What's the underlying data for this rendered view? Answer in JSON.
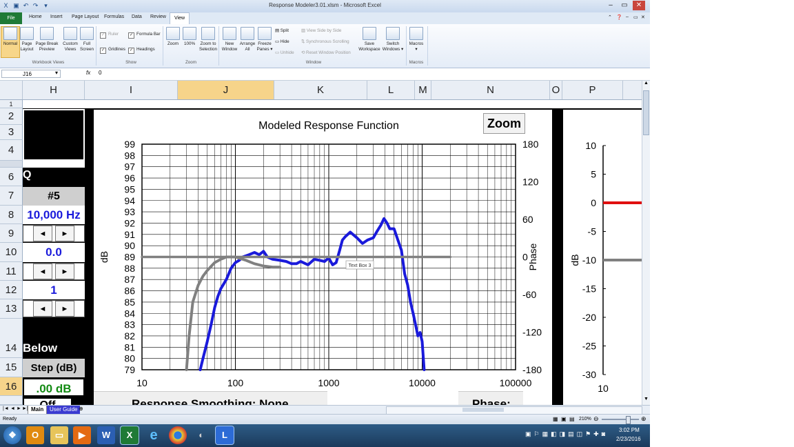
{
  "window": {
    "title": "Response Modeler3.01.xlsm - Microsoft Excel"
  },
  "ribbon": {
    "tabs": [
      "Home",
      "Insert",
      "Page Layout",
      "Formulas",
      "Data",
      "Review",
      "View"
    ],
    "file_tab": "File",
    "active_tab": "View",
    "groups": {
      "workbook_views": {
        "label": "Workbook Views",
        "normal": "Normal",
        "page_layout": [
          "Page",
          "Layout"
        ],
        "page_break": [
          "Page Break",
          "Preview"
        ],
        "custom_views": [
          "Custom",
          "Views"
        ],
        "full_screen": [
          "Full",
          "Screen"
        ]
      },
      "show": {
        "label": "Show",
        "ruler": "Ruler",
        "formula_bar": "Formula Bar",
        "gridlines": "Gridlines",
        "headings": "Headings"
      },
      "zoom": {
        "label": "Zoom",
        "zoom": "Zoom",
        "hundred": "100%",
        "zoom_to_selection": [
          "Zoom to",
          "Selection"
        ]
      },
      "window": {
        "label": "Window",
        "new_window": [
          "New",
          "Window"
        ],
        "arrange_all": [
          "Arrange",
          "All"
        ],
        "freeze_panes": [
          "Freeze",
          "Panes ▾"
        ],
        "split": "Split",
        "hide": "Hide",
        "unhide": "Unhide",
        "view_side": "View Side by Side",
        "sync_scroll": "Synchronous Scrolling",
        "reset_pos": "Reset Window Position",
        "save_workspace": [
          "Save",
          "Workspace"
        ],
        "switch_windows": [
          "Switch",
          "Windows ▾"
        ]
      },
      "macros": {
        "label": "Macros",
        "macros": "Macros"
      }
    }
  },
  "formula_bar": {
    "name_box": "J16",
    "fx": "fx",
    "value": "0"
  },
  "columns": [
    "H",
    "I",
    "J",
    "K",
    "L",
    "M",
    "N",
    "O",
    "P"
  ],
  "rows": [
    "1",
    "2",
    "3",
    "4",
    "6",
    "7",
    "8",
    "9",
    "10",
    "11",
    "12",
    "13",
    "14",
    "15",
    "16"
  ],
  "panel": {
    "q_label": "Q",
    "band": "#5",
    "freq": "10,000 Hz",
    "gain": "0.0",
    "q_value": "1",
    "below": "Below",
    "step_label": "Step (dB)",
    "step_value": ".00 dB",
    "off_label": "Off",
    "arrow_left": "◄",
    "arrow_right": "►"
  },
  "chart_main": {
    "title": "Modeled Response Function",
    "zoom_button": "Zoom",
    "y_left_label": "dB",
    "y_right_label": "Phase",
    "y_ticks": [
      "99",
      "98",
      "97",
      "96",
      "95",
      "94",
      "93",
      "92",
      "91",
      "90",
      "89",
      "88",
      "87",
      "86",
      "85",
      "84",
      "83",
      "82",
      "81",
      "80",
      "79"
    ],
    "phase_ticks": [
      "180",
      "120",
      "60",
      "0",
      "-60",
      "-120",
      "-180"
    ],
    "x_ticks": [
      "10",
      "100",
      "1000",
      "10000",
      "100000"
    ],
    "textbox_label": "Text Box 3",
    "smoothing_label": "Response  Smoothing:  None",
    "phase_label": "Phase:"
  },
  "chart_data": [
    {
      "type": "line",
      "title": "Modeled Response Function",
      "xlabel": "",
      "ylabel": "dB",
      "y2label": "Phase",
      "xscale": "log",
      "xlim": [
        10,
        100000
      ],
      "ylim": [
        79,
        99
      ],
      "y2lim": [
        -180,
        180
      ],
      "grid": true,
      "series": [
        {
          "color": "#1a1adb",
          "axis": "left",
          "x": [
            42,
            45,
            50,
            55,
            60,
            65,
            70,
            80,
            90,
            100,
            110,
            120,
            140,
            160,
            180,
            200,
            220,
            250,
            300,
            350,
            400,
            450,
            500,
            600,
            700,
            800,
            900,
            1000,
            1100,
            1200,
            1300,
            1400,
            1500,
            1700,
            2000,
            2300,
            2600,
            3000,
            3300,
            3600,
            3900,
            4200,
            4500,
            5000,
            5500,
            6000,
            6500,
            7000,
            7500,
            8000,
            8500,
            9000,
            9500,
            10000,
            10500
          ],
          "y": [
            79,
            80,
            81.5,
            83,
            84.5,
            85.5,
            86.2,
            87,
            88,
            88.5,
            88.7,
            89,
            89.2,
            89.4,
            89.2,
            89.5,
            89,
            88.8,
            88.7,
            88.6,
            88.4,
            88.4,
            88.6,
            88.3,
            88.8,
            88.7,
            88.6,
            88.9,
            88.3,
            88.5,
            89.5,
            90.5,
            90.8,
            91.2,
            90.7,
            90.2,
            90.5,
            90.7,
            91.3,
            91.8,
            92.4,
            92,
            91.5,
            91.5,
            90.5,
            89.6,
            87.5,
            86.5,
            85,
            84,
            83,
            82,
            82.3,
            81.5,
            79
          ]
        },
        {
          "color": "#808080",
          "axis": "left",
          "x": [
            30,
            32,
            35,
            40,
            45,
            50,
            60,
            70,
            80,
            90,
            100,
            130,
            160,
            200,
            250,
            300
          ],
          "y": [
            79,
            82,
            85,
            86.5,
            87.3,
            87.8,
            88.5,
            88.8,
            89,
            89,
            89,
            88.7,
            88.4,
            88.2,
            88.1,
            88.1
          ]
        },
        {
          "color": "#808080",
          "axis": "right",
          "x": [
            10,
            20000
          ],
          "y": [
            0,
            0
          ]
        }
      ]
    },
    {
      "type": "line",
      "xlabel": "",
      "ylabel": "dB",
      "ylim": [
        -30,
        10
      ],
      "y_ticks": [
        "10",
        "5",
        "0",
        "-5",
        "-10",
        "-15",
        "-20",
        "-25",
        "-30"
      ],
      "x_first_tick": "10",
      "series": [
        {
          "color": "#e01010",
          "x": [
            10,
            100000
          ],
          "y": [
            0,
            0
          ]
        },
        {
          "color": "#808080",
          "x": [
            10,
            100000
          ],
          "y": [
            -10,
            -10
          ]
        }
      ]
    }
  ],
  "sheet_tabs": [
    "Main",
    "User Guide"
  ],
  "status": {
    "ready": "Ready",
    "zoom": "210%"
  },
  "clock": {
    "time": "3:02 PM",
    "date": "2/23/2016"
  }
}
